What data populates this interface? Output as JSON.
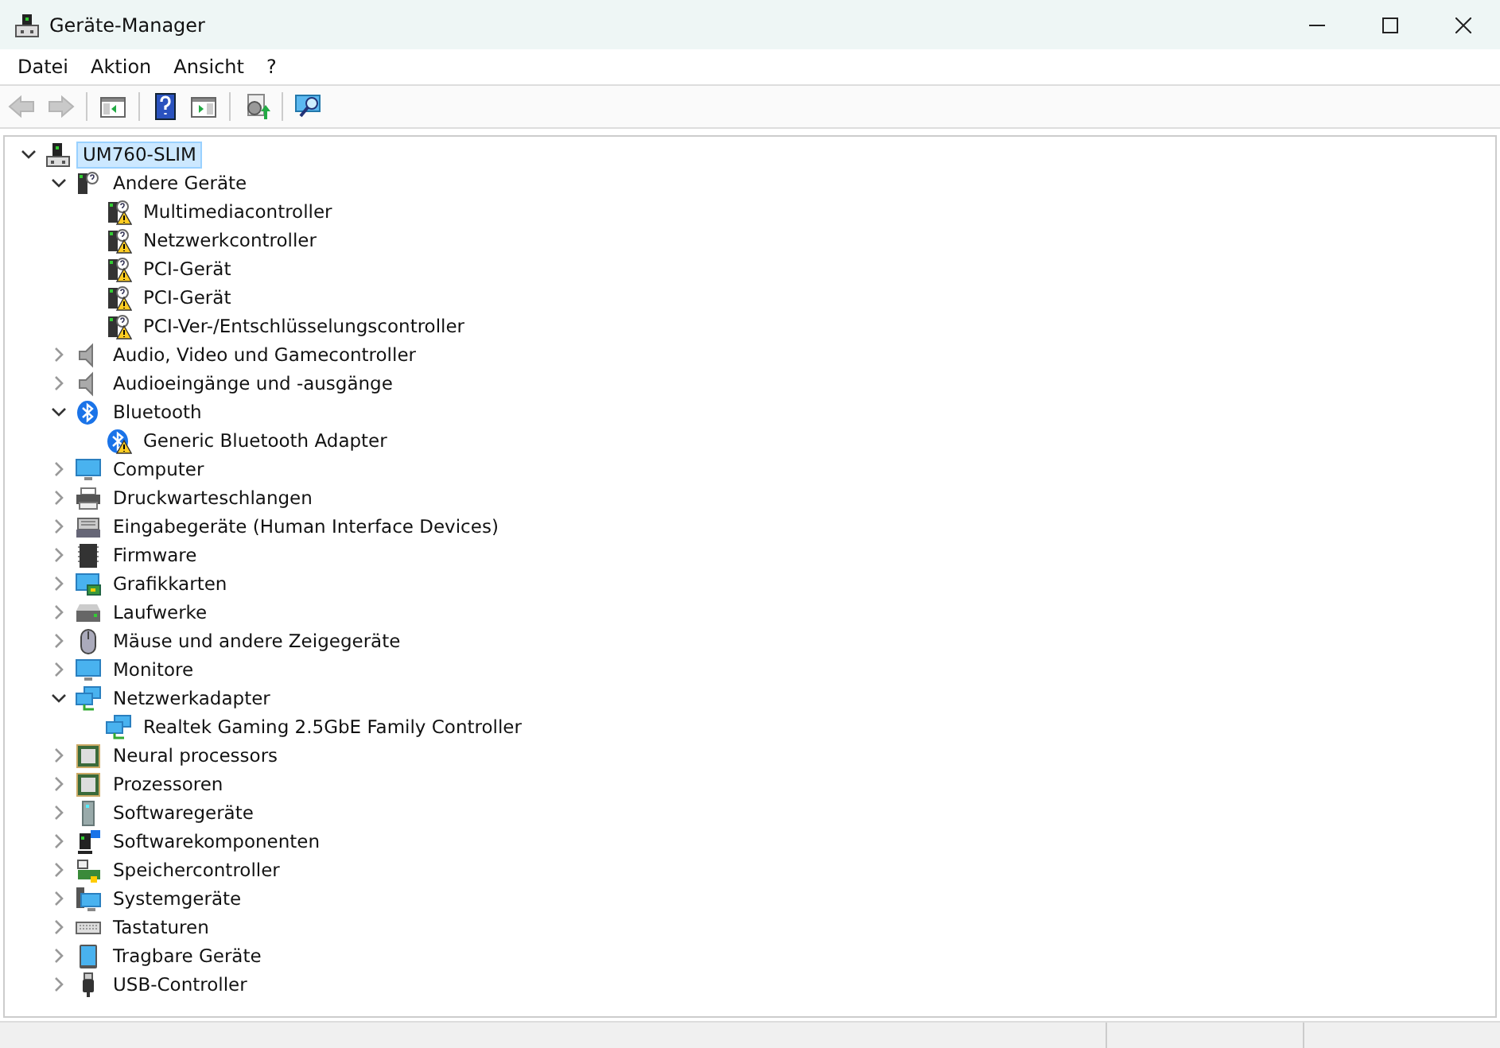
{
  "window": {
    "title": "Geräte-Manager"
  },
  "menu": [
    "Datei",
    "Aktion",
    "Ansicht",
    "?"
  ],
  "toolbar": [
    {
      "disabled": true
    },
    {
      "disabled": true
    },
    {
      "disabled": false
    },
    {
      "disabled": false
    },
    {
      "disabled": false
    },
    {
      "disabled": false
    },
    {
      "disabled": false
    }
  ],
  "tree": {
    "label": "UM760-SLIM",
    "kind": "computer",
    "selected": true,
    "expanded": true,
    "children": [
      {
        "label": "Andere Geräte",
        "kind": "unknown",
        "expanded": true,
        "children": [
          {
            "label": "Multimediacontroller",
            "kind": "unknown",
            "warning": true
          },
          {
            "label": "Netzwerkcontroller",
            "kind": "unknown",
            "warning": true
          },
          {
            "label": "PCI-Gerät",
            "kind": "unknown",
            "warning": true
          },
          {
            "label": "PCI-Gerät",
            "kind": "unknown",
            "warning": true
          },
          {
            "label": "PCI-Ver-/Entschlüsselungscontroller",
            "kind": "unknown",
            "warning": true
          }
        ]
      },
      {
        "label": "Audio, Video und Gamecontroller",
        "kind": "speaker",
        "expanded": false
      },
      {
        "label": "Audioeingänge und -ausgänge",
        "kind": "speaker",
        "expanded": false
      },
      {
        "label": "Bluetooth",
        "kind": "bluetooth",
        "expanded": true,
        "children": [
          {
            "label": "Generic Bluetooth Adapter",
            "kind": "bluetooth",
            "warning": true
          }
        ]
      },
      {
        "label": "Computer",
        "kind": "monitor",
        "expanded": false
      },
      {
        "label": "Druckwarteschlangen",
        "kind": "printer",
        "expanded": false
      },
      {
        "label": "Eingabegeräte (Human Interface Devices)",
        "kind": "input",
        "expanded": false
      },
      {
        "label": "Firmware",
        "kind": "firmware",
        "expanded": false
      },
      {
        "label": "Grafikkarten",
        "kind": "graphics",
        "expanded": false
      },
      {
        "label": "Laufwerke",
        "kind": "drive",
        "expanded": false
      },
      {
        "label": "Mäuse und andere Zeigegeräte",
        "kind": "mouse",
        "expanded": false
      },
      {
        "label": "Monitore",
        "kind": "monitor",
        "expanded": false
      },
      {
        "label": "Netzwerkadapter",
        "kind": "network",
        "expanded": true,
        "children": [
          {
            "label": "Realtek Gaming 2.5GbE Family Controller",
            "kind": "network",
            "warning": false
          }
        ]
      },
      {
        "label": "Neural processors",
        "kind": "processor",
        "expanded": false
      },
      {
        "label": "Prozessoren",
        "kind": "processor",
        "expanded": false
      },
      {
        "label": "Softwaregeräte",
        "kind": "software",
        "expanded": false
      },
      {
        "label": "Softwarekomponenten",
        "kind": "component",
        "expanded": false
      },
      {
        "label": "Speichercontroller",
        "kind": "storage",
        "expanded": false
      },
      {
        "label": "Systemgeräte",
        "kind": "system",
        "expanded": false
      },
      {
        "label": "Tastaturen",
        "kind": "keyboard",
        "expanded": false
      },
      {
        "label": "Tragbare Geräte",
        "kind": "portable",
        "expanded": false
      },
      {
        "label": "USB-Controller",
        "kind": "usb",
        "expanded": false
      }
    ]
  }
}
